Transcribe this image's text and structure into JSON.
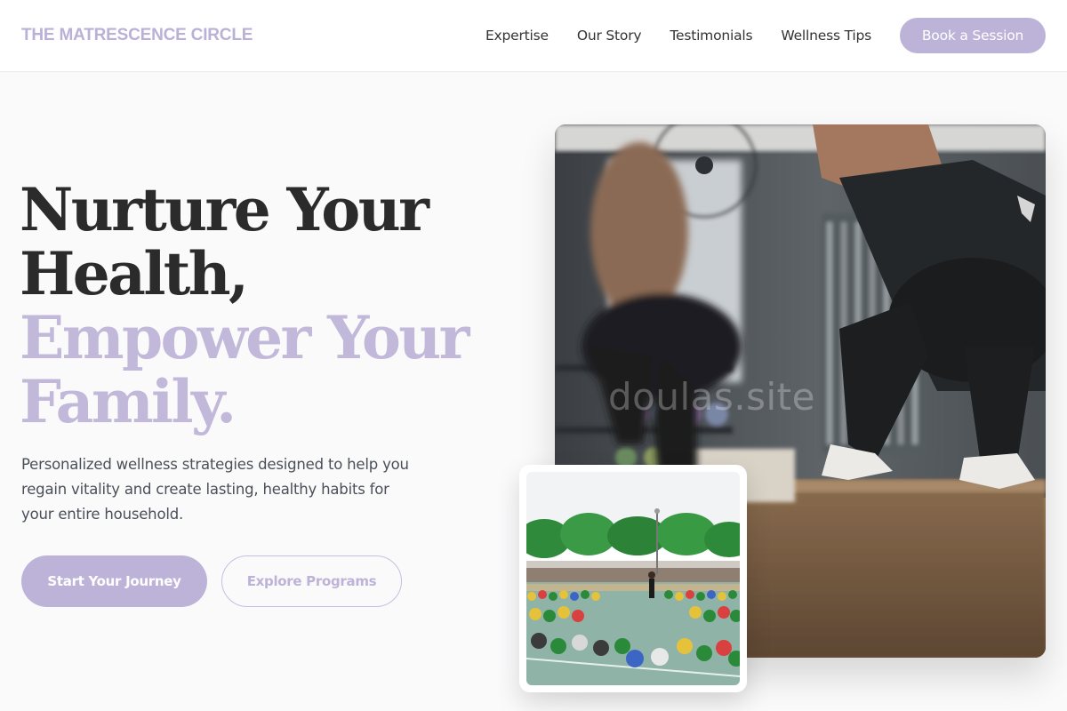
{
  "brand": {
    "name": "THE MATRESCENCE CIRCLE"
  },
  "nav": {
    "links": [
      "Expertise",
      "Our Story",
      "Testimonials",
      "Wellness Tips"
    ],
    "cta": "Book a Session"
  },
  "hero": {
    "headline": [
      "Nurture Your",
      "Health,",
      "Empower Your",
      "Family."
    ],
    "subtitle": "Personalized wellness strategies designed to help you regain vitality and create lasting, healthy habits for your entire household.",
    "primary_cta": "Start Your Journey",
    "secondary_cta": "Explore Programs"
  },
  "images": {
    "main_watermark": "doulas.site"
  },
  "colors": {
    "accent": "#bdb3d8",
    "headline_dark": "#2b2b2b",
    "headline_accent": "#c1b8da",
    "body_text": "#4a4f58",
    "background": "#fafafb"
  }
}
